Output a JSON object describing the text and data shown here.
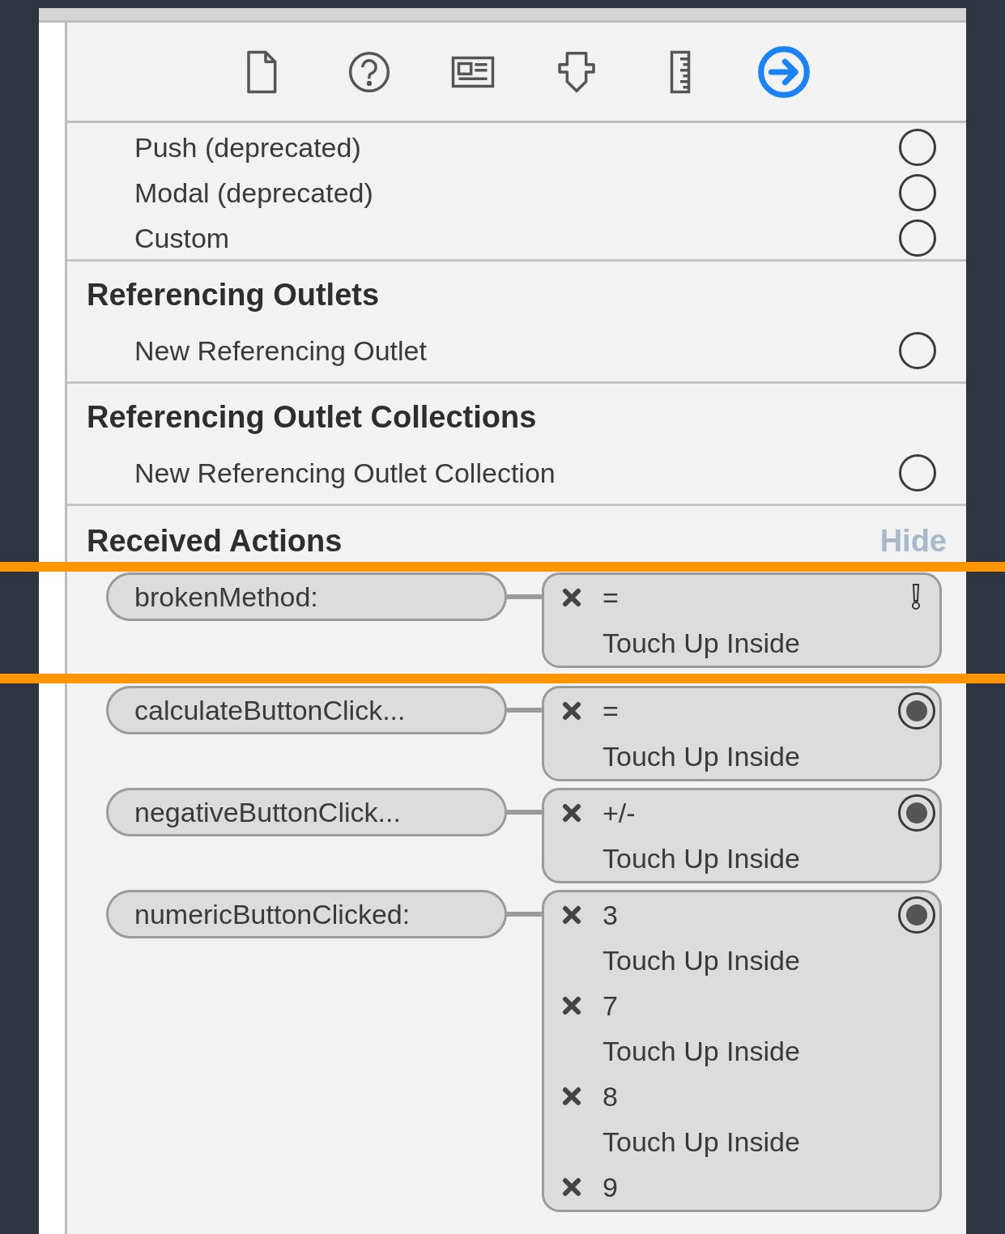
{
  "toolbar": {
    "tabs": [
      {
        "kind": "file",
        "selected": false
      },
      {
        "kind": "help",
        "selected": false
      },
      {
        "kind": "identity",
        "selected": false
      },
      {
        "kind": "attributes",
        "selected": false
      },
      {
        "kind": "size",
        "selected": false
      },
      {
        "kind": "connections",
        "selected": true
      }
    ]
  },
  "segues": {
    "items": [
      {
        "label": "Push (deprecated)",
        "connected": false
      },
      {
        "label": "Modal (deprecated)",
        "connected": false
      },
      {
        "label": "Custom",
        "connected": false
      }
    ]
  },
  "referencing_outlets": {
    "title": "Referencing Outlets",
    "items": [
      {
        "label": "New Referencing Outlet",
        "connected": false
      }
    ]
  },
  "referencing_outlet_collections": {
    "title": "Referencing Outlet Collections",
    "items": [
      {
        "label": "New Referencing Outlet Collection",
        "connected": false
      }
    ]
  },
  "received_actions": {
    "title": "Received Actions",
    "hide_link": "Hide",
    "actions": [
      {
        "method": "brokenMethod:",
        "broken": true,
        "connections": [
          {
            "sender": "=",
            "event": "Touch Up Inside"
          }
        ]
      },
      {
        "method": "calculateButtonClick...",
        "broken": false,
        "connections": [
          {
            "sender": "=",
            "event": "Touch Up Inside"
          }
        ]
      },
      {
        "method": "negativeButtonClick...",
        "broken": false,
        "connections": [
          {
            "sender": "+/-",
            "event": "Touch Up Inside"
          }
        ]
      },
      {
        "method": "numericButtonClicked:",
        "broken": false,
        "connections": [
          {
            "sender": "3",
            "event": "Touch Up Inside"
          },
          {
            "sender": "7",
            "event": "Touch Up Inside"
          },
          {
            "sender": "8",
            "event": "Touch Up Inside"
          },
          {
            "sender": "9"
          }
        ]
      }
    ]
  }
}
